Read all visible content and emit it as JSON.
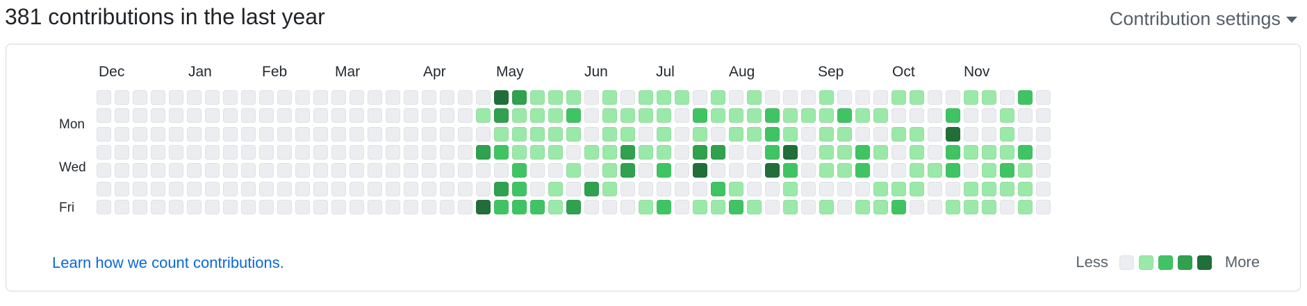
{
  "header": {
    "title": "381 contributions in the last year",
    "settings_label": "Contribution settings"
  },
  "calendar": {
    "months": [
      "Dec",
      "Jan",
      "Feb",
      "Mar",
      "Apr",
      "May",
      "Jun",
      "Jul",
      "Aug",
      "Sep",
      "Oct",
      "Nov"
    ],
    "day_labels": [
      "Mon",
      "Wed",
      "Fri"
    ],
    "level_colors": [
      "#ebedf0",
      "#9be9a8",
      "#40c463",
      "#30a14e",
      "#216e39"
    ],
    "weeks": [
      [
        0,
        0,
        0,
        0,
        0,
        0,
        0
      ],
      [
        0,
        0,
        0,
        0,
        0,
        0,
        0
      ],
      [
        0,
        0,
        0,
        0,
        0,
        0,
        0
      ],
      [
        0,
        0,
        0,
        0,
        0,
        0,
        0
      ],
      [
        0,
        0,
        0,
        0,
        0,
        0,
        0
      ],
      [
        0,
        0,
        0,
        0,
        0,
        0,
        0
      ],
      [
        0,
        0,
        0,
        0,
        0,
        0,
        0
      ],
      [
        0,
        0,
        0,
        0,
        0,
        0,
        0
      ],
      [
        0,
        0,
        0,
        0,
        0,
        0,
        0
      ],
      [
        0,
        0,
        0,
        0,
        0,
        0,
        0
      ],
      [
        0,
        0,
        0,
        0,
        0,
        0,
        0
      ],
      [
        0,
        0,
        0,
        0,
        0,
        0,
        0
      ],
      [
        0,
        0,
        0,
        0,
        0,
        0,
        0
      ],
      [
        0,
        0,
        0,
        0,
        0,
        0,
        0
      ],
      [
        0,
        0,
        0,
        0,
        0,
        0,
        0
      ],
      [
        0,
        0,
        0,
        0,
        0,
        0,
        0
      ],
      [
        0,
        0,
        0,
        0,
        0,
        0,
        0
      ],
      [
        0,
        0,
        0,
        0,
        0,
        0,
        0
      ],
      [
        0,
        0,
        0,
        0,
        0,
        0,
        0
      ],
      [
        0,
        0,
        0,
        0,
        0,
        0,
        0
      ],
      [
        0,
        0,
        0,
        0,
        0,
        0,
        0
      ],
      [
        0,
        1,
        0,
        3,
        0,
        0,
        4
      ],
      [
        4,
        3,
        1,
        2,
        0,
        3,
        2
      ],
      [
        3,
        1,
        1,
        1,
        2,
        2,
        2
      ],
      [
        1,
        1,
        1,
        1,
        0,
        0,
        2
      ],
      [
        1,
        1,
        1,
        1,
        0,
        1,
        1
      ],
      [
        1,
        2,
        1,
        0,
        1,
        0,
        3
      ],
      [
        0,
        0,
        0,
        1,
        0,
        3,
        0
      ],
      [
        1,
        1,
        1,
        1,
        1,
        1,
        0
      ],
      [
        0,
        1,
        1,
        3,
        3,
        0,
        0
      ],
      [
        1,
        1,
        0,
        1,
        0,
        0,
        1
      ],
      [
        1,
        1,
        1,
        1,
        2,
        0,
        2
      ],
      [
        1,
        0,
        0,
        0,
        0,
        0,
        0
      ],
      [
        0,
        2,
        1,
        3,
        4,
        0,
        1
      ],
      [
        1,
        1,
        0,
        3,
        0,
        2,
        1
      ],
      [
        0,
        1,
        1,
        0,
        0,
        1,
        2
      ],
      [
        1,
        1,
        1,
        0,
        0,
        0,
        1
      ],
      [
        0,
        2,
        2,
        2,
        4,
        0,
        0
      ],
      [
        0,
        1,
        1,
        4,
        2,
        1,
        1
      ],
      [
        0,
        1,
        0,
        0,
        0,
        0,
        0
      ],
      [
        1,
        1,
        1,
        1,
        1,
        0,
        1
      ],
      [
        0,
        2,
        1,
        1,
        1,
        0,
        0
      ],
      [
        0,
        1,
        0,
        2,
        2,
        0,
        1
      ],
      [
        0,
        1,
        0,
        1,
        0,
        1,
        1
      ],
      [
        1,
        0,
        1,
        0,
        0,
        1,
        2
      ],
      [
        1,
        0,
        1,
        1,
        1,
        1,
        0
      ],
      [
        0,
        0,
        0,
        0,
        1,
        0,
        0
      ],
      [
        0,
        2,
        4,
        2,
        2,
        0,
        1
      ],
      [
        1,
        0,
        0,
        1,
        0,
        1,
        1
      ],
      [
        1,
        0,
        0,
        1,
        1,
        1,
        1
      ],
      [
        0,
        1,
        1,
        1,
        2,
        1,
        0
      ],
      [
        2,
        0,
        0,
        2,
        1,
        1,
        1
      ],
      [
        0,
        0,
        0,
        0,
        0,
        0,
        0
      ]
    ]
  },
  "footer": {
    "learn_link": "Learn how we count contributions.",
    "legend_less": "Less",
    "legend_more": "More"
  }
}
